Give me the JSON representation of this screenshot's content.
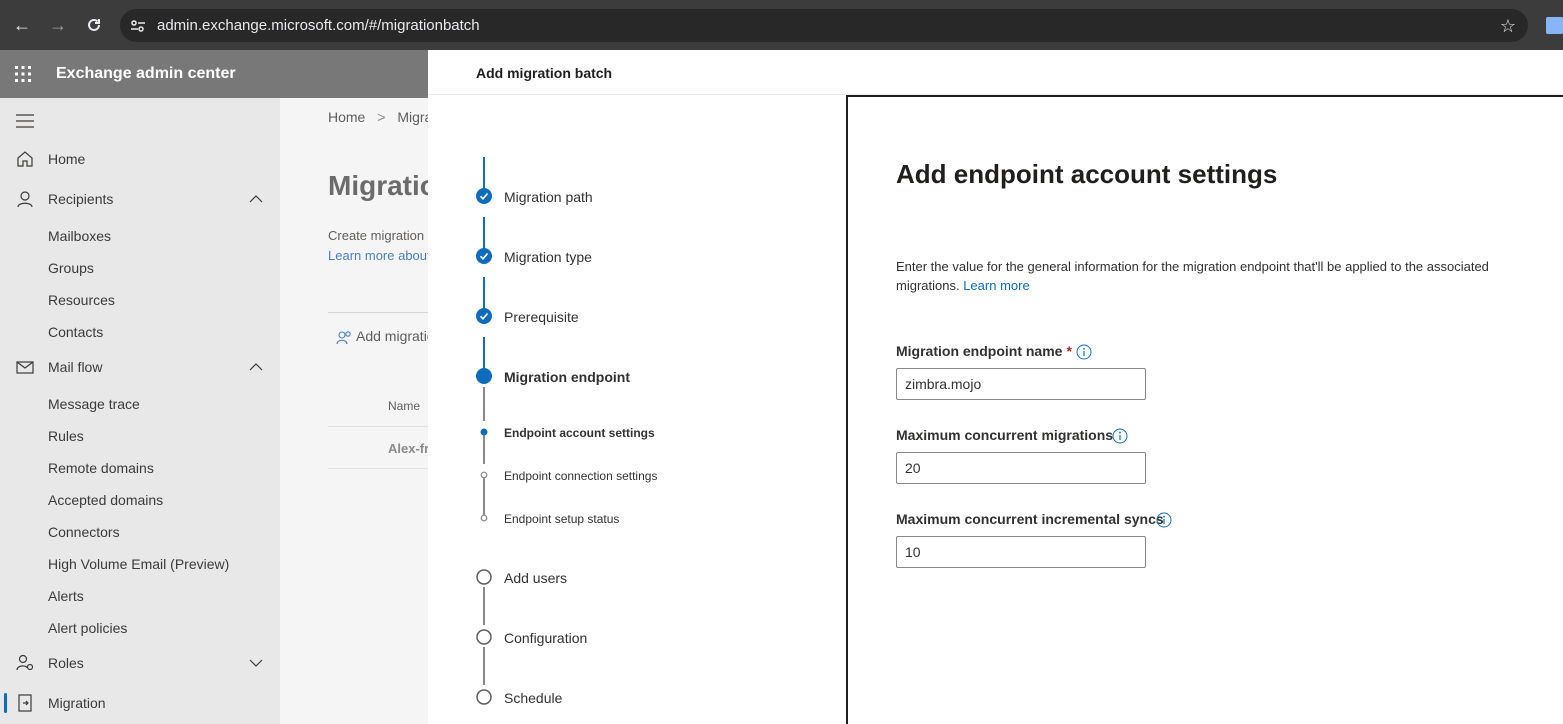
{
  "browser": {
    "url": "admin.exchange.microsoft.com/#/migrationbatch"
  },
  "app": {
    "title": "Exchange admin center"
  },
  "sidebar": {
    "items": [
      {
        "label": "Home",
        "icon": "home-icon"
      },
      {
        "label": "Recipients",
        "icon": "person-icon",
        "expanded": true
      },
      {
        "label": "Mail flow",
        "icon": "mail-icon",
        "expanded": true
      },
      {
        "label": "Roles",
        "icon": "roles-icon",
        "expanded": false
      },
      {
        "label": "Migration",
        "icon": "migration-icon",
        "active": true
      }
    ],
    "recipients_sub": [
      "Mailboxes",
      "Groups",
      "Resources",
      "Contacts"
    ],
    "mailflow_sub": [
      "Message trace",
      "Rules",
      "Remote domains",
      "Accepted domains",
      "Connectors",
      "High Volume Email (Preview)",
      "Alerts",
      "Alert policies"
    ]
  },
  "background": {
    "breadcrumb_home": "Home",
    "breadcrumb_sep": ">",
    "breadcrumb_current": "Migration",
    "title": "Migration",
    "desc": "Create migration",
    "link": "Learn more about",
    "cmd": "Add migration",
    "col_name": "Name",
    "row_name": "Alex-from"
  },
  "panel": {
    "title": "Add migration batch",
    "steps": [
      {
        "label": "Migration path",
        "state": "done"
      },
      {
        "label": "Migration type",
        "state": "done"
      },
      {
        "label": "Prerequisite",
        "state": "done"
      },
      {
        "label": "Migration endpoint",
        "state": "current"
      },
      {
        "label": "Endpoint account settings",
        "state": "sub-current"
      },
      {
        "label": "Endpoint connection settings",
        "state": "sub-pending"
      },
      {
        "label": "Endpoint setup status",
        "state": "sub-pending"
      },
      {
        "label": "Add users",
        "state": "pending"
      },
      {
        "label": "Configuration",
        "state": "pending"
      },
      {
        "label": "Schedule",
        "state": "pending"
      }
    ]
  },
  "content": {
    "title": "Add endpoint account settings",
    "desc": "Enter the value for the general information for the migration endpoint that'll be applied to the associated migrations.",
    "learn_more": "Learn more",
    "fields": [
      {
        "label": "Migration endpoint name",
        "required_mark": "*",
        "value": "zimbra.mojo"
      },
      {
        "label": "Maximum concurrent migrations",
        "value": "20"
      },
      {
        "label": "Maximum concurrent incremental syncs",
        "value": "10"
      }
    ]
  },
  "colors": {
    "accent": "#0f6cbd",
    "header": "#787878",
    "sidebar": "#e8e8e8"
  }
}
